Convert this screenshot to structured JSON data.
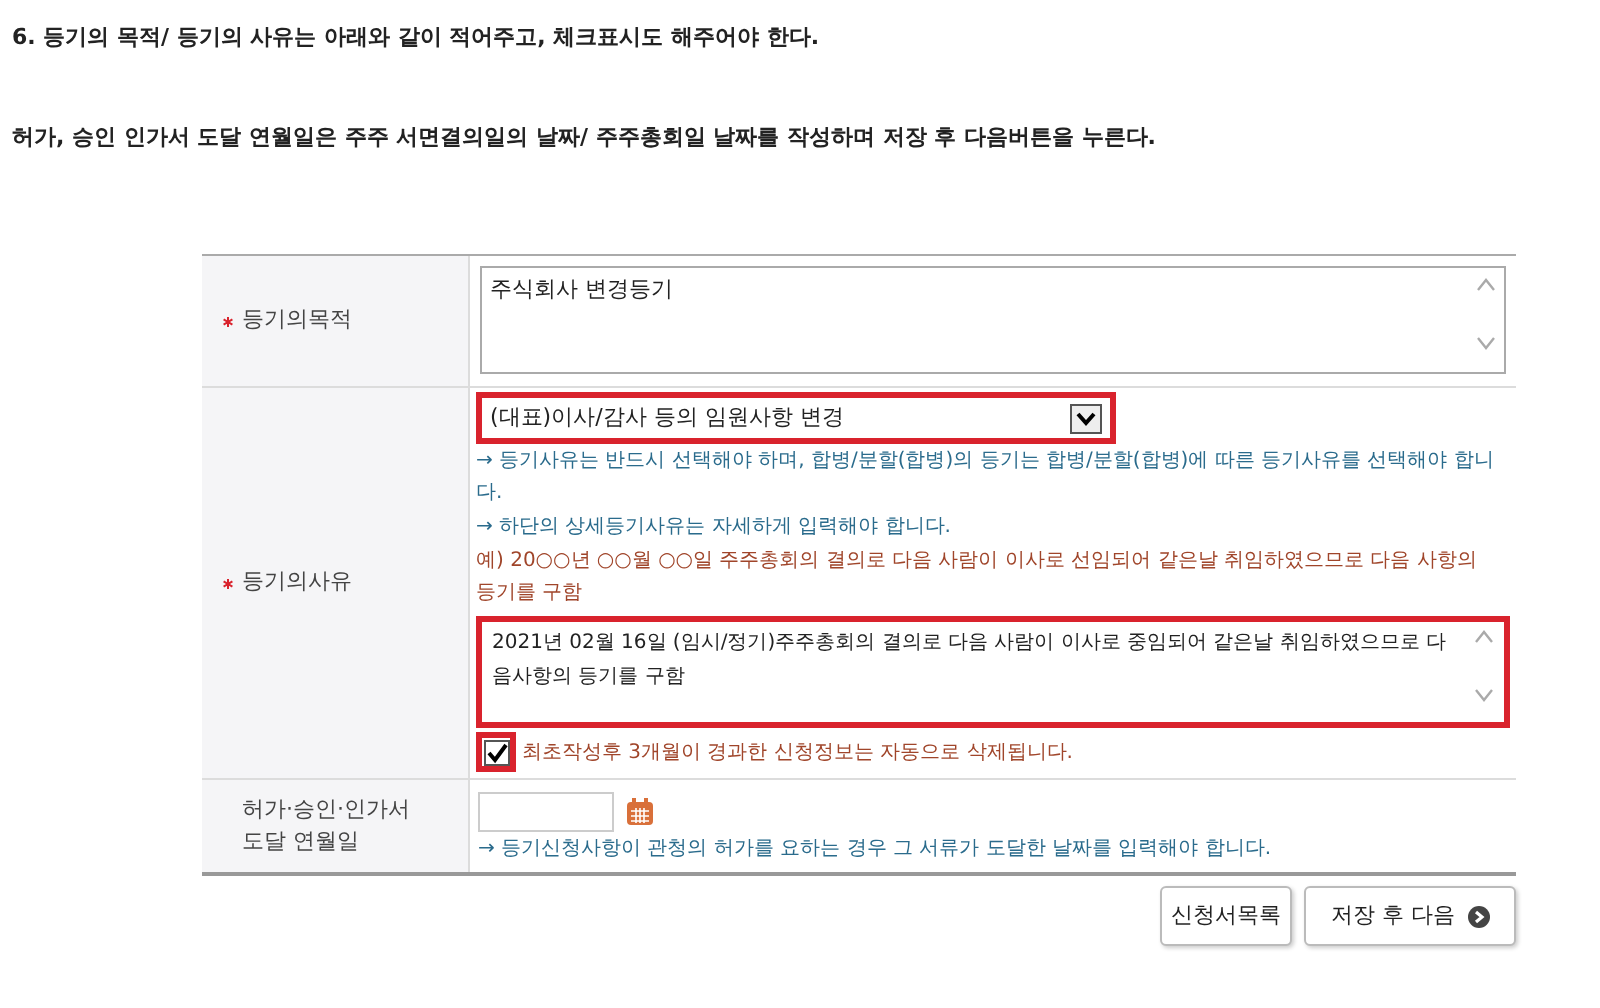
{
  "instructions": [
    "6. 등기의 목적/ 등기의 사유는 아래와 같이 적어주고, 체크표시도 해주어야 한다.",
    "허가, 승인 인가서 도달 연월일은 주주 서면결의일의 날짜/ 주주총회일 날짜를 작성하며 저장 후 다음버튼을 누른다."
  ],
  "form": {
    "purpose": {
      "label": "등기의목적",
      "required": true,
      "value": "주식회사 변경등기"
    },
    "reason": {
      "label": "등기의사유",
      "required": true,
      "select": {
        "value": "(대표)이사/감사 등의 임원사항 변경",
        "highlighted": true
      },
      "hints": [
        "→ 등기사유는 반드시 선택해야 하며, 합병/분할(합병)의 등기는 합병/분할(합병)에 따른 등기사유를 선택해야 합니다.",
        "→ 하단의 상세등기사유는 자세하게 입력해야 합니다."
      ],
      "example": "예) 20○○년 ○○월 ○○일 주주총회의 결의로 다음 사람이 이사로 선임되어 같은날 취임하였으므로 다음 사항의 등기를 구함",
      "detail": {
        "value": "2021년 02월 16일 (임시/정기)주주총회의 결의로 다음 사람이 이사로 중임되어 같은날 취임하였으므로 다음사항의 등기를 구함",
        "highlighted": true
      },
      "notice": {
        "label": "최초작성후 3개월이 경과한 신청정보는 자동으로 삭제됩니다.",
        "checked": true,
        "highlighted": true
      }
    },
    "date": {
      "label_lines": [
        "허가·승인·인가서",
        "도달 연월일"
      ],
      "required": false,
      "hint": "→ 등기신청사항이 관청의 허가를 요하는 경우 그 서류가 도달한 날짜를 입력해야 합니다."
    }
  },
  "buttons": [
    {
      "label": "신청서목록",
      "kind": "plain"
    },
    {
      "label": "저장 후 다음",
      "kind": "next"
    }
  ]
}
